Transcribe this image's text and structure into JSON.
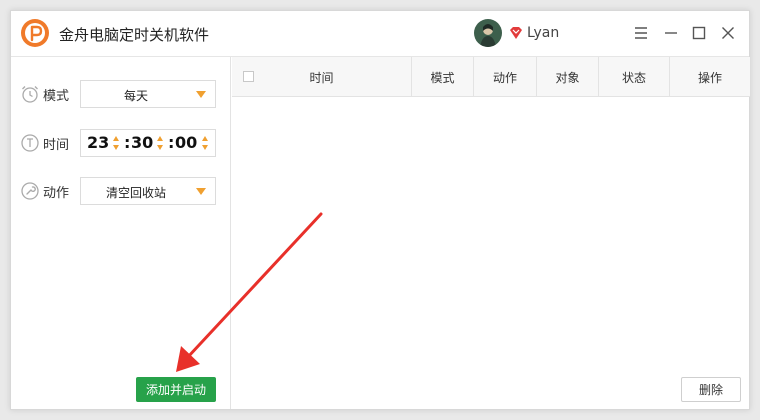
{
  "app": {
    "title": "金舟电脑定时关机软件"
  },
  "user": {
    "name": "Lyan"
  },
  "window_controls": [
    "menu-icon",
    "minimize-icon",
    "maximize-icon",
    "close-icon"
  ],
  "form": {
    "mode": {
      "label": "模式",
      "value": "每天",
      "icon": "alarm-clock-icon"
    },
    "time": {
      "label": "时间",
      "hour": "23",
      "minute": "30",
      "second": "00",
      "separator": ":",
      "icon": "clock-icon"
    },
    "action": {
      "label": "动作",
      "value": "清空回收站",
      "icon": "wrench-icon"
    }
  },
  "buttons": {
    "add_start": "添加并启动",
    "delete": "删除"
  },
  "table": {
    "columns": [
      "时间",
      "模式",
      "动作",
      "对象",
      "状态",
      "操作"
    ],
    "rows": []
  },
  "colors": {
    "accent_orange": "#f0a030",
    "add_button_green": "#27a24a",
    "annotation_arrow": "#e8302a"
  }
}
